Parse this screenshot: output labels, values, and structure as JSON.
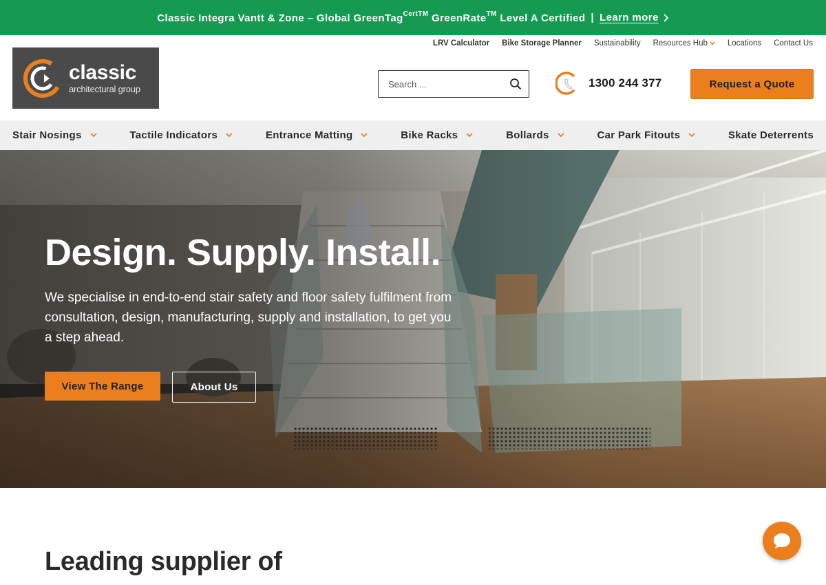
{
  "announcement": {
    "text_before": "Classic Integra Vantt & Zone – Global GreenTag",
    "sup_cert": "CertTM",
    "text_mid": " GreenRate",
    "sup_tm": "TM",
    "text_after": " Level A Certified",
    "separator": "|",
    "link_label": "Learn more",
    "bg_color": "#149a51"
  },
  "utility_links": [
    {
      "label": "LRV Calculator"
    },
    {
      "label": "Bike Storage Planner"
    },
    {
      "label": "Sustainability"
    },
    {
      "label": "Resources Hub"
    },
    {
      "label": "Locations"
    },
    {
      "label": "Contact Us"
    }
  ],
  "logo": {
    "word": "classic",
    "sub": "architectural group"
  },
  "search": {
    "placeholder": "Search ...",
    "icon": "search-icon"
  },
  "phone": {
    "number": "1300 244 377",
    "icon": "phone-icon"
  },
  "quote_button": "Request a Quote",
  "nav": [
    {
      "label": "Stair Nosings",
      "has_dropdown": true
    },
    {
      "label": "Tactile Indicators",
      "has_dropdown": true
    },
    {
      "label": "Entrance Matting",
      "has_dropdown": true
    },
    {
      "label": "Bike Racks",
      "has_dropdown": true
    },
    {
      "label": "Bollards",
      "has_dropdown": true
    },
    {
      "label": "Car Park Fitouts",
      "has_dropdown": true
    },
    {
      "label": "Skate Deterrents",
      "has_dropdown": false
    }
  ],
  "hero": {
    "heading": "Design. Supply. Install.",
    "body": "We specialise in end-to-end stair safety and floor safety fulfilment from consultation, design, manufacturing, supply and installation, to get you a step ahead.",
    "primary_button": "View The Range",
    "secondary_button": "About Us"
  },
  "section_heading": "Leading supplier of",
  "chat_icon": "chat-bubble-icon",
  "colors": {
    "accent": "#ec7f1d",
    "green": "#149a51",
    "dark": "#4a4a4b"
  }
}
